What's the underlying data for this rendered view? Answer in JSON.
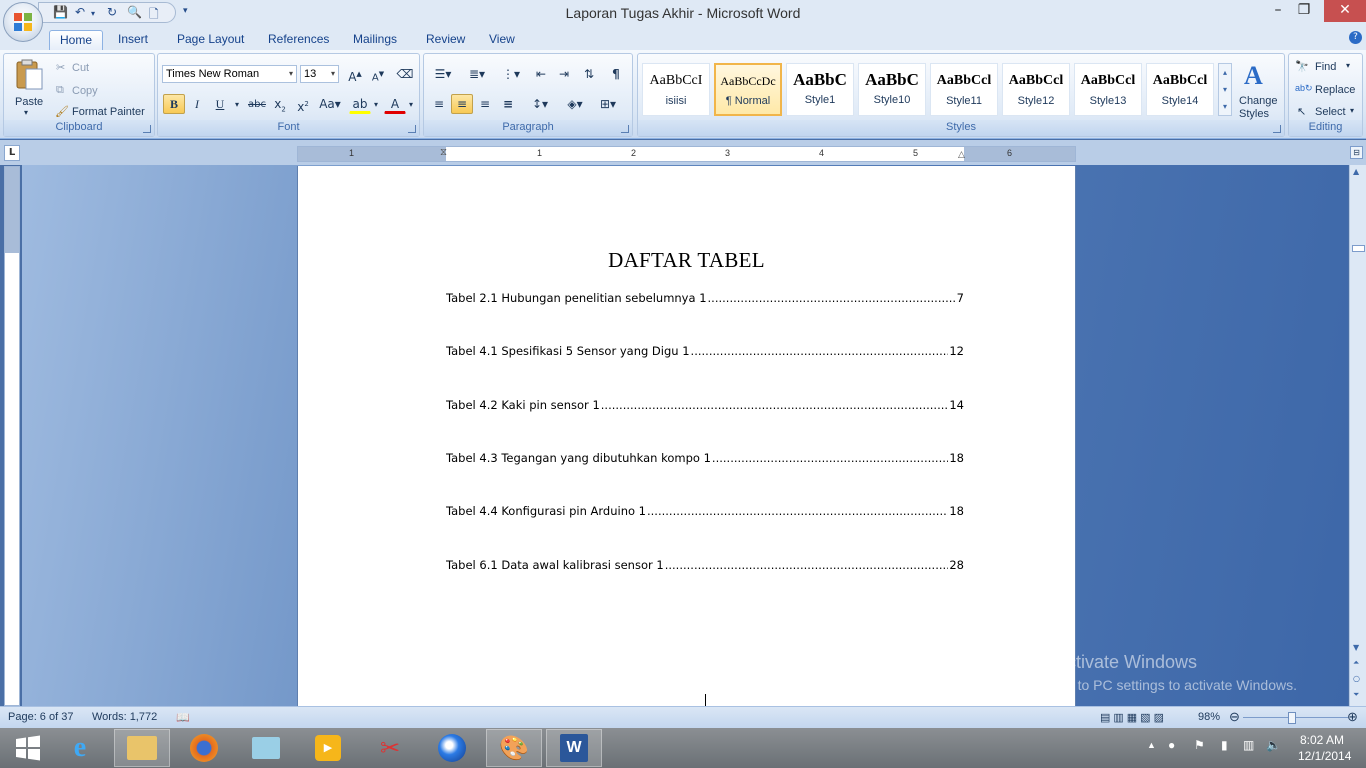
{
  "window": {
    "title": "Laporan Tugas Akhir - Microsoft Word"
  },
  "tabs": [
    "Home",
    "Insert",
    "Page Layout",
    "References",
    "Mailings",
    "Review",
    "View"
  ],
  "clipboard": {
    "paste": "Paste",
    "cut": "Cut",
    "copy": "Copy",
    "format_painter": "Format Painter",
    "label": "Clipboard"
  },
  "font": {
    "name": "Times New Roman",
    "size": "13",
    "label": "Font"
  },
  "paragraph": {
    "label": "Paragraph"
  },
  "styles": {
    "items": [
      {
        "sample": "AaBbCcI",
        "name": "isiisi"
      },
      {
        "sample": "AaBbCcDc",
        "name": "¶ Normal"
      },
      {
        "sample": "AaBbC",
        "name": "Style1"
      },
      {
        "sample": "AaBbC",
        "name": "Style10"
      },
      {
        "sample": "AaBbCcl",
        "name": "Style11"
      },
      {
        "sample": "AaBbCcl",
        "name": "Style12"
      },
      {
        "sample": "AaBbCcl",
        "name": "Style13"
      },
      {
        "sample": "AaBbCcl",
        "name": "Style14"
      }
    ],
    "change_styles_1": "Change",
    "change_styles_2": "Styles",
    "label": "Styles"
  },
  "editing": {
    "find": "Find",
    "replace": "Replace",
    "select": "Select",
    "label": "Editing"
  },
  "ruler_numbers": [
    "1",
    "1",
    "2",
    "3",
    "4",
    "5",
    "6"
  ],
  "document": {
    "heading": "DAFTAR TABEL",
    "toc": [
      {
        "label": "Tabel 2.1 Hubungan penelitian sebelumnya 1",
        "page": "7"
      },
      {
        "label": "Tabel 4.1 Spesifikasi 5 Sensor yang Digu 1",
        "page": "12"
      },
      {
        "label": "Tabel 4.2 Kaki pin sensor 1",
        "page": "14"
      },
      {
        "label": "Tabel 4.3 Tegangan yang dibutuhkan kompo 1",
        "page": "18"
      },
      {
        "label": "Tabel 4.4 Konfigurasi pin Arduino 1",
        "page": "18"
      },
      {
        "label": "Tabel 6.1 Data awal kalibrasi sensor 1",
        "page": "28"
      }
    ]
  },
  "status": {
    "page": "Page: 6 of 37",
    "words": "Words: 1,772",
    "zoom": "98%"
  },
  "watermark": {
    "line1": "Activate Windows",
    "line2": "Go to PC settings to activate Windows."
  },
  "clock": {
    "time": "8:02 AM",
    "date": "12/1/2014"
  },
  "colors": {
    "accent": "#15428b",
    "ribbon_bg": "#dbe7f5",
    "style_selected": "#f1b54a"
  }
}
